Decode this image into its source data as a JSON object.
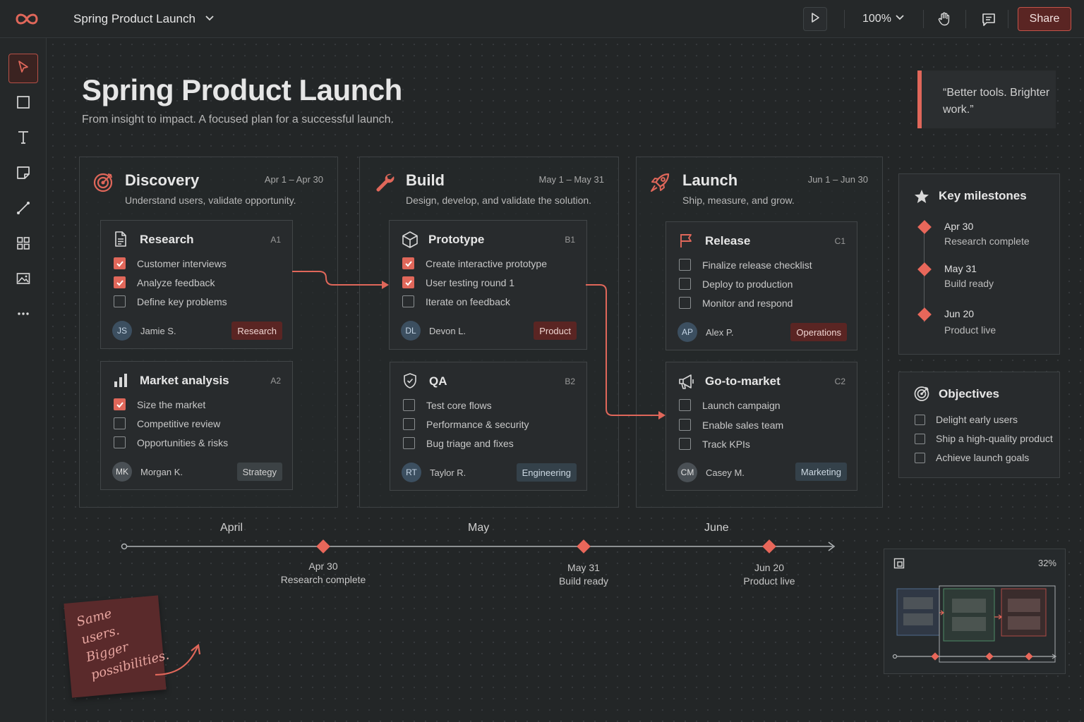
{
  "topbar": {
    "doc_title": "Spring Product Launch",
    "zoom": "100%",
    "share_label": "Share",
    "icons": [
      "infinity-logo-icon",
      "chevron-down-icon",
      "play-icon",
      "hand-icon",
      "comment-icon"
    ]
  },
  "toolbar": {
    "tools": [
      "select-tool",
      "rectangle-tool",
      "text-tool",
      "sticky-note-tool",
      "connector-tool",
      "components-tool",
      "image-tool",
      "more-tool"
    ]
  },
  "header": {
    "title": "Spring Product Launch",
    "subtitle": "From insight to impact. A focused plan for a successful launch.",
    "quote": "“Better tools. Brighter work.”"
  },
  "phases": [
    {
      "title": "Discovery",
      "dates": "Apr 1 – Apr 30",
      "subtitle": "Understand users, validate opportunity.",
      "cards": [
        {
          "title": "Research",
          "code": "A1",
          "items": [
            {
              "label": "Customer interviews",
              "checked": true
            },
            {
              "label": "Analyze feedback",
              "checked": true
            },
            {
              "label": "Define key problems",
              "checked": false
            }
          ],
          "initials": "JS",
          "person": "Jamie S.",
          "tag": "Research"
        },
        {
          "title": "Market analysis",
          "code": "A2",
          "items": [
            {
              "label": "Size the market",
              "checked": true
            },
            {
              "label": "Competitive review",
              "checked": false
            },
            {
              "label": "Opportunities & risks",
              "checked": false
            }
          ],
          "initials": "MK",
          "person": "Morgan K.",
          "tag": "Strategy"
        }
      ]
    },
    {
      "title": "Build",
      "dates": "May 1 – May 31",
      "subtitle": "Design, develop, and validate the solution.",
      "cards": [
        {
          "title": "Prototype",
          "code": "B1",
          "items": [
            {
              "label": "Create interactive prototype",
              "checked": true
            },
            {
              "label": "User testing round 1",
              "checked": true
            },
            {
              "label": "Iterate on feedback",
              "checked": false
            }
          ],
          "initials": "DL",
          "person": "Devon L.",
          "tag": "Product"
        },
        {
          "title": "QA",
          "code": "B2",
          "items": [
            {
              "label": "Test core flows",
              "checked": false
            },
            {
              "label": "Performance & security",
              "checked": false
            },
            {
              "label": "Bug triage and fixes",
              "checked": false
            }
          ],
          "initials": "RT",
          "person": "Taylor R.",
          "tag": "Engineering"
        }
      ]
    },
    {
      "title": "Launch",
      "dates": "Jun 1 – Jun 30",
      "subtitle": "Ship, measure, and grow.",
      "cards": [
        {
          "title": "Release",
          "code": "C1",
          "items": [
            {
              "label": "Finalize release checklist",
              "checked": false
            },
            {
              "label": "Deploy to production",
              "checked": false
            },
            {
              "label": "Monitor and respond",
              "checked": false
            }
          ],
          "initials": "AP",
          "person": "Alex P.",
          "tag": "Operations"
        },
        {
          "title": "Go-to-market",
          "code": "C2",
          "items": [
            {
              "label": "Launch campaign",
              "checked": false
            },
            {
              "label": "Enable sales team",
              "checked": false
            },
            {
              "label": "Track KPIs",
              "checked": false
            }
          ],
          "initials": "CM",
          "person": "Casey M.",
          "tag": "Marketing"
        }
      ]
    }
  ],
  "milestones_panel": {
    "title": "Key milestones",
    "items": [
      {
        "date": "Apr 30",
        "label": "Research complete"
      },
      {
        "date": "May 31",
        "label": "Build ready"
      },
      {
        "date": "Jun 20",
        "label": "Product live"
      }
    ]
  },
  "objectives_panel": {
    "title": "Objectives",
    "items": [
      {
        "label": "Delight early users",
        "checked": false
      },
      {
        "label": "Ship a high-quality product",
        "checked": false
      },
      {
        "label": "Achieve launch goals",
        "checked": false
      }
    ]
  },
  "timeline": {
    "months": [
      "April",
      "May",
      "June"
    ],
    "milestones": [
      {
        "date": "Apr 30",
        "label": "Research complete"
      },
      {
        "date": "May 31",
        "label": "Build ready"
      },
      {
        "date": "Jun 20",
        "label": "Product live"
      }
    ]
  },
  "sticky_note": {
    "text": "Same\nusers.\nBigger\npossibilities."
  },
  "minimap": {
    "zoom": "32%"
  },
  "colors": {
    "accent": "#e0675a",
    "accent_dark": "#5a2523",
    "background": "#232627"
  }
}
